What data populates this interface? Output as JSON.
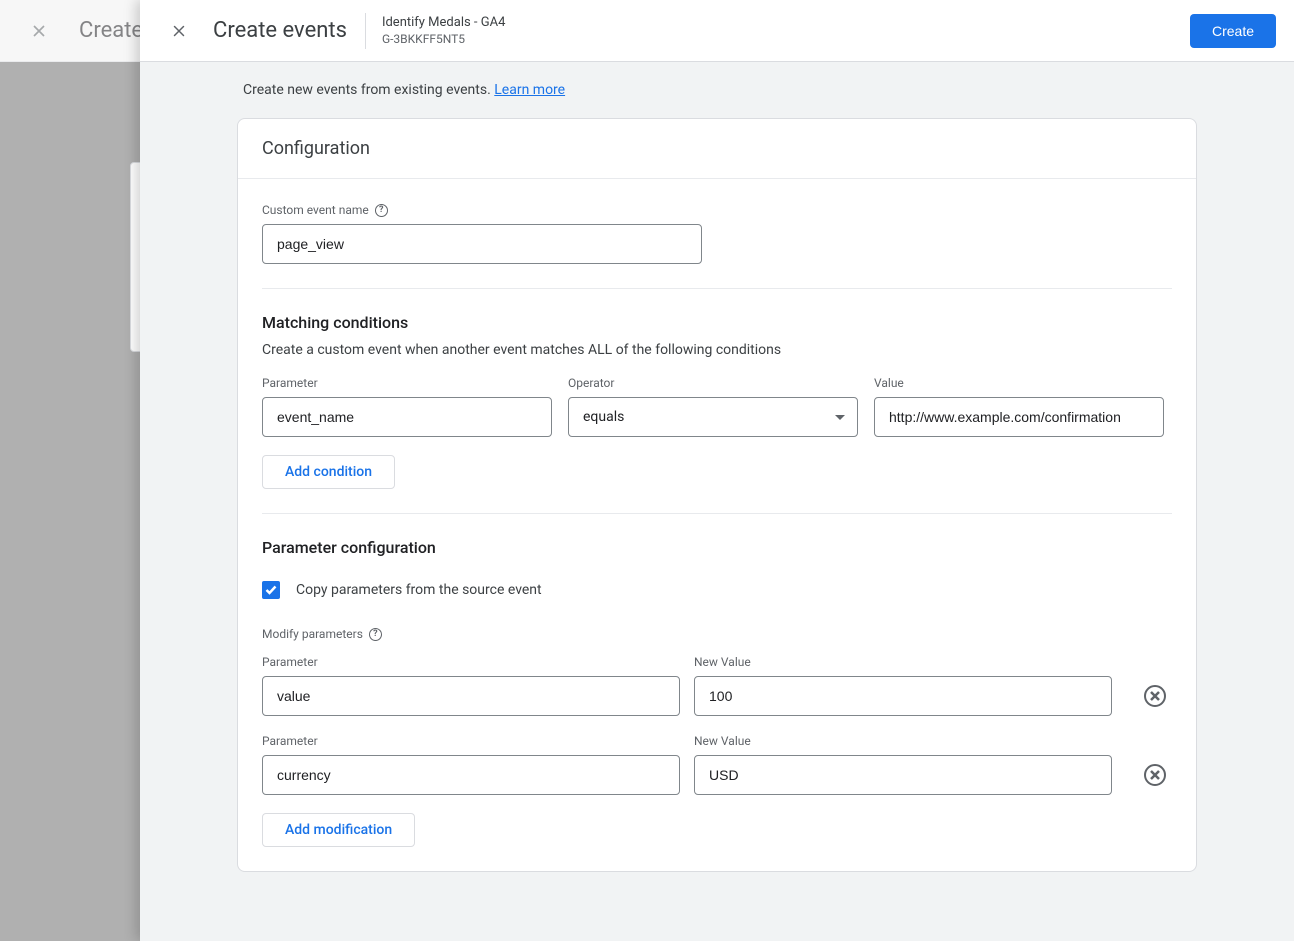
{
  "background": {
    "title_fragment": "Create"
  },
  "header": {
    "title": "Create events",
    "property_name": "Identify Medals - GA4",
    "stream_id": "G-3BKKFF5NT5",
    "create_label": "Create"
  },
  "intro": {
    "text": "Create new events from existing events. ",
    "link_text": "Learn more"
  },
  "config": {
    "title": "Configuration",
    "custom_event_label": "Custom event name",
    "custom_event_value": "page_view"
  },
  "matching": {
    "title": "Matching conditions",
    "subtitle": "Create a custom event when another event matches ALL of the following conditions",
    "parameter_label": "Parameter",
    "operator_label": "Operator",
    "value_label": "Value",
    "rows": [
      {
        "parameter": "event_name",
        "operator": "equals",
        "value": "http://www.example.com/confirmation"
      }
    ],
    "add_condition_label": "Add condition"
  },
  "param_config": {
    "title": "Parameter configuration",
    "copy_label": "Copy parameters from the source event",
    "copy_checked": true,
    "modify_label": "Modify parameters",
    "col_parameter": "Parameter",
    "col_new_value": "New Value",
    "rows": [
      {
        "parameter": "value",
        "new_value": "100"
      },
      {
        "parameter": "currency",
        "new_value": "USD"
      }
    ],
    "add_modification_label": "Add modification"
  }
}
